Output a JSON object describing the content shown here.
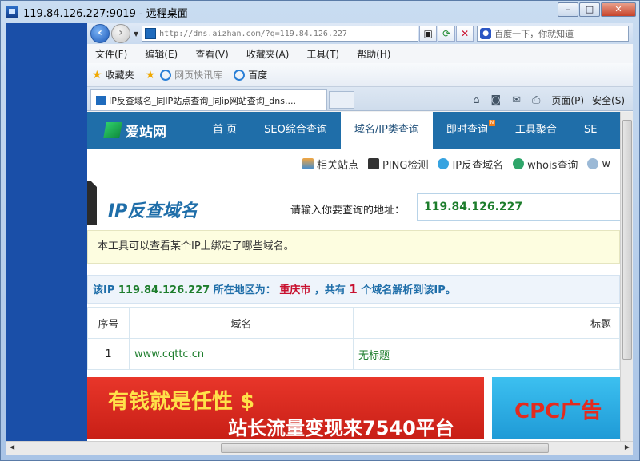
{
  "rdp": {
    "title": "119.84.126.227:9019 - 远程桌面",
    "btn_min": "‒",
    "btn_max": "□",
    "btn_close": "✕"
  },
  "ie": {
    "address": "http://dns.aizhan.com/?q=119.84.126.227",
    "search_placeholder": "百度一下，你就知道",
    "menu": [
      "文件(F)",
      "编辑(E)",
      "查看(V)",
      "收藏夹(A)",
      "工具(T)",
      "帮助(H)"
    ],
    "favorites_label": "收藏夹",
    "fav_items": [
      "网页快讯库",
      "百度"
    ],
    "tab_title": "IP反查域名_同IP站点查询_同ip网站查询_dns....",
    "cmd_page": "页面(P)",
    "cmd_safety": "安全(S)"
  },
  "site": {
    "logo_text": "爱站网",
    "nav": [
      "首 页",
      "SEO综合查询",
      "域名/IP类查询",
      "即时查询",
      "工具聚合",
      "SE"
    ],
    "subtools": [
      "相关站点",
      "PING检测",
      "IP反查域名",
      "whois查询",
      "w"
    ],
    "tool_title": "IP反查域名",
    "query_label": "请输入你要查询的地址：",
    "query_value": "119.84.126.227",
    "notice": "本工具可以查看某个IP上绑定了哪些域名。",
    "result": {
      "prefix": "该IP",
      "ip": "119.84.126.227",
      "mid": "所在地区为：",
      "city": "重庆市",
      "mid2": "，共有",
      "count": "1",
      "suffix": "个域名解析到该IP。"
    },
    "table": {
      "headers": [
        "序号",
        "域名",
        "标题"
      ],
      "rows": [
        {
          "num": "1",
          "domain": "www.cqttc.cn",
          "title": "无标题"
        }
      ]
    },
    "ad1": {
      "line1": "有钱就是任性 $",
      "line2": "站长流量变现来7540平台"
    },
    "ad2": {
      "line": "CPC广告"
    }
  }
}
